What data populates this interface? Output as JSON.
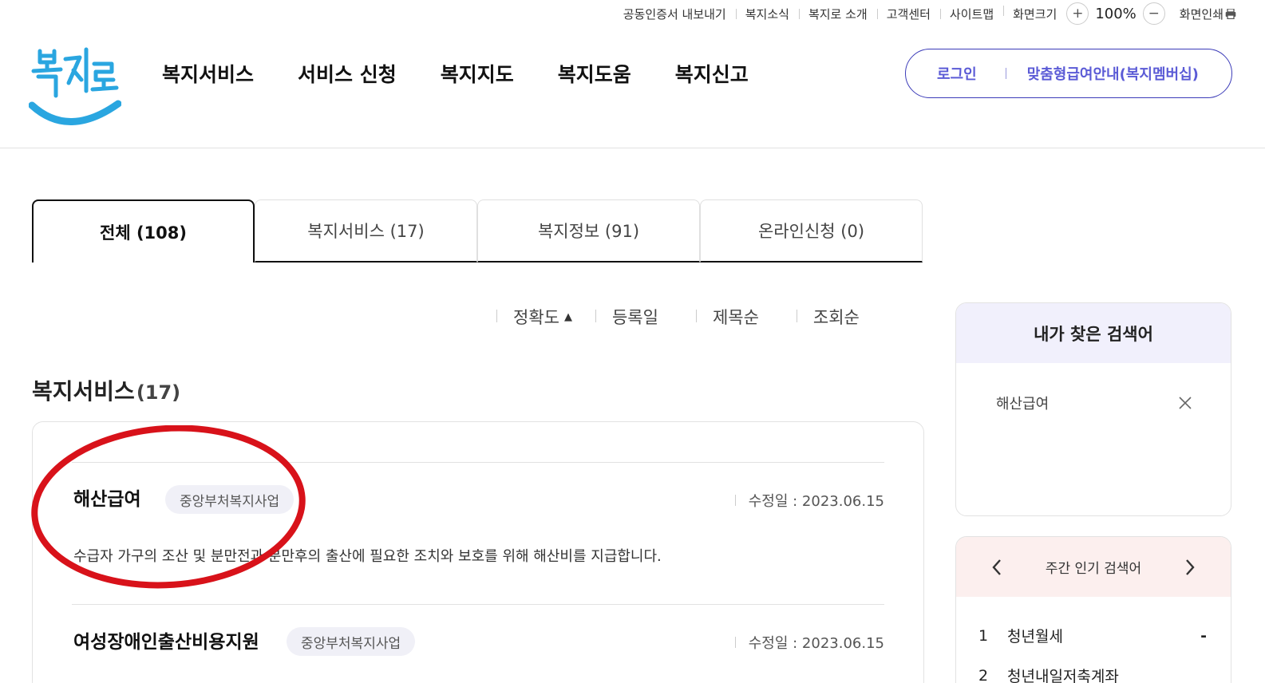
{
  "utility": {
    "links": [
      "공동인증서 내보내기",
      "복지소식",
      "복지로 소개",
      "고객센터",
      "사이트맵"
    ],
    "zoom_label": "화면크기",
    "zoom_in": "+",
    "zoom_value": "100%",
    "zoom_out": "−",
    "print_label": "화면인쇄"
  },
  "logo": {
    "text": "복지로"
  },
  "gnb": [
    "복지서비스",
    "서비스 신청",
    "복지지도",
    "복지도움",
    "복지신고"
  ],
  "auth": {
    "login": "로그인",
    "membership": "맞춤형급여안내(복지멤버십)"
  },
  "tabs": [
    {
      "label": "전체  (108)",
      "active": true
    },
    {
      "label": "복지서비스 (17)",
      "active": false
    },
    {
      "label": "복지정보 (91)",
      "active": false
    },
    {
      "label": "온라인신청 (0)",
      "active": false
    }
  ],
  "sort": {
    "options": [
      "정확도",
      "등록일",
      "제목순",
      "조회순"
    ],
    "active_caret": "▲"
  },
  "section": {
    "title": "복지서비스",
    "count": "(17)"
  },
  "results": [
    {
      "title": "해산급여",
      "badge": "중앙부처복지사업",
      "date": "수정일 : 2023.06.15",
      "desc": "수급자 가구의 조산 및 분만전과 분만후의 출산에 필요한 조치와 보호를 위해 해산비를 지급합니다."
    },
    {
      "title": "여성장애인출산비용지원",
      "badge": "중앙부처복지사업",
      "date": "수정일 : 2023.06.15"
    }
  ],
  "my_search": {
    "title": "내가 찾은 검색어",
    "keyword": "해산급여"
  },
  "popular": {
    "title": "주간 인기 검색어",
    "items": [
      {
        "rank": "1",
        "keyword": "청년월세",
        "trend": "-"
      },
      {
        "rank": "2",
        "keyword": "청년내일저축계좌",
        "trend": ""
      }
    ]
  },
  "colors": {
    "brand_blue": "#3b3bb8",
    "annotation_red": "#d8121a",
    "logo_blue": "#2aa6e0"
  }
}
